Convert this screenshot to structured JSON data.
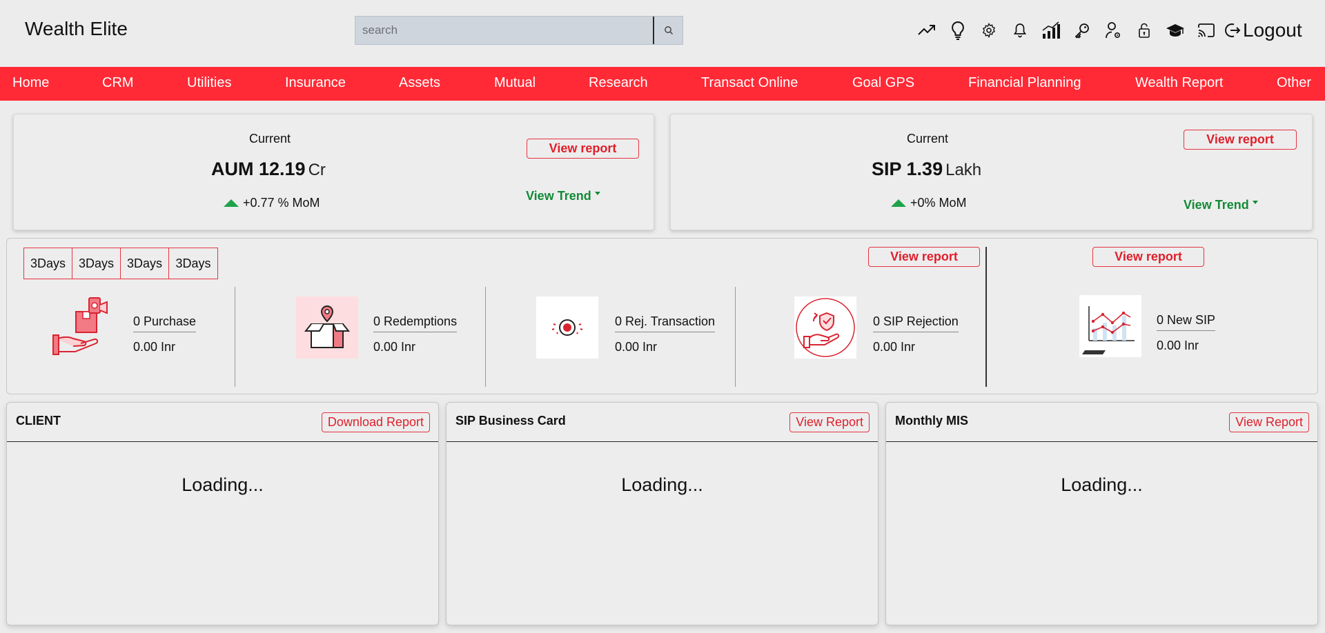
{
  "app": {
    "title": "Wealth Elite"
  },
  "search": {
    "placeholder": "search"
  },
  "header": {
    "logout_label": "Logout"
  },
  "nav": {
    "items": [
      "Home",
      "CRM",
      "Utilities",
      "Insurance",
      "Assets",
      "Mutual",
      "Research",
      "Transact Online",
      "Goal GPS",
      "Financial Planning",
      "Wealth Report",
      "Other"
    ]
  },
  "aum_card": {
    "current_label": "Current",
    "metric_label": "AUM 12.19",
    "unit": "Cr",
    "change": "+0.77 % MoM",
    "view_report": "View report",
    "view_trend": "View Trend"
  },
  "sip_card": {
    "current_label": "Current",
    "metric_label": "SIP 1.39",
    "unit": "Lakh",
    "change": "+0% MoM",
    "view_report": "View report",
    "view_trend": "View Trend"
  },
  "transactions": {
    "day_buttons": [
      "3Days",
      "3Days",
      "3Days",
      "3Days"
    ],
    "view_report_1": "View report",
    "view_report_2": "View report",
    "items": [
      {
        "label": "0 Purchase",
        "value": "0.00 Inr"
      },
      {
        "label": "0 Redemptions",
        "value": "0.00 Inr"
      },
      {
        "label": "0 Rej. Transaction",
        "value": "0.00 Inr"
      },
      {
        "label": "0 SIP Rejection",
        "value": "0.00 Inr"
      },
      {
        "label": "0 New SIP",
        "value": "0.00 Inr"
      }
    ]
  },
  "bottom_cards": [
    {
      "title": "CLIENT",
      "button": "Download Report",
      "status": "Loading..."
    },
    {
      "title": "SIP Business Card",
      "button": "View Report",
      "status": "Loading..."
    },
    {
      "title": "Monthly MIS",
      "button": "View Report",
      "status": "Loading..."
    }
  ],
  "colors": {
    "nav": "#ff2a36",
    "accent_red": "#e01f2c",
    "trend_green": "#128a37",
    "up_arrow": "#1fa34a"
  }
}
